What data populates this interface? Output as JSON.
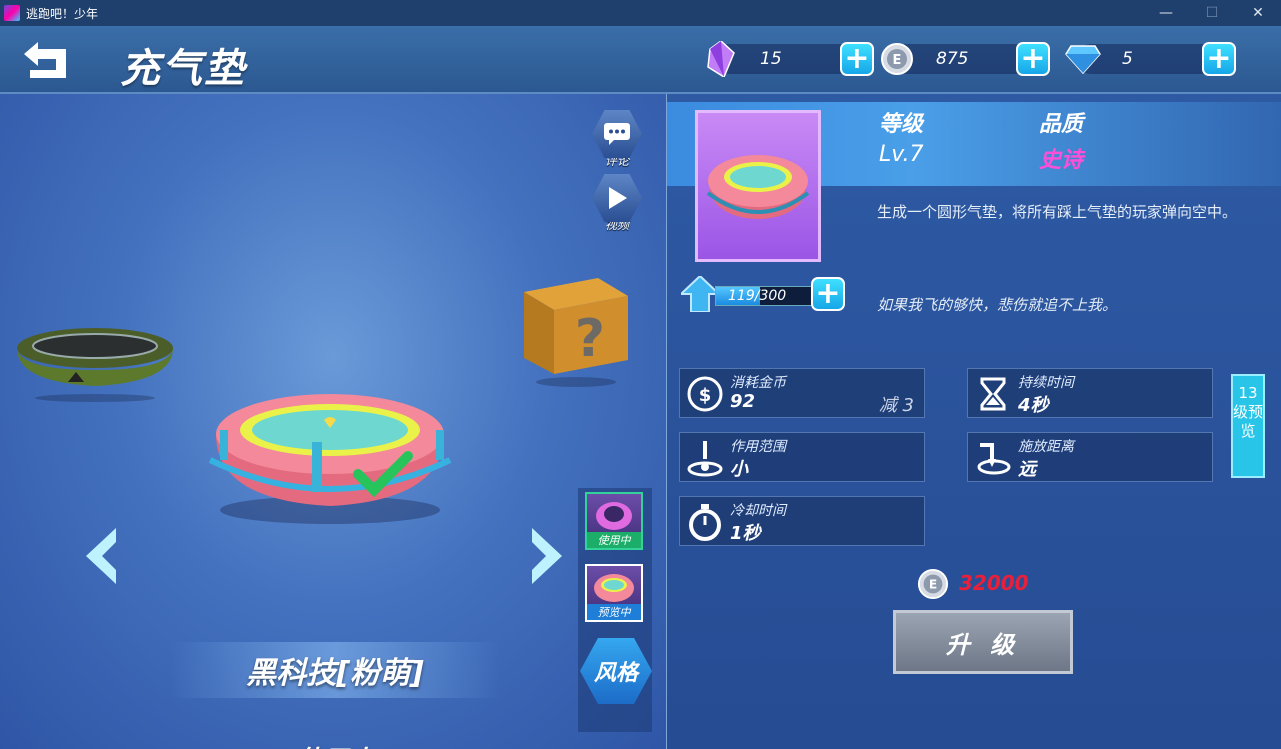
{
  "window": {
    "title": "逃跑吧！少年",
    "minimize": "—",
    "maximize": "☐",
    "close": "✕"
  },
  "header": {
    "page_title": "充气垫"
  },
  "currencies": [
    {
      "name": "crystal",
      "value": "15",
      "color": "#b56cf0"
    },
    {
      "name": "coin",
      "value": "875",
      "color": "#c7cfdc"
    },
    {
      "name": "diamond",
      "value": "5",
      "color": "#5fc7ff"
    }
  ],
  "side_buttons": {
    "comment": "评论",
    "video": "视频"
  },
  "styles": {
    "in_use_tag": "使用中",
    "preview_tag": "预览中",
    "style_button": "风格"
  },
  "skin": {
    "name": "黑科技[粉萌]",
    "status": "使用中"
  },
  "item": {
    "level_label": "等级",
    "level_value": "Lv.7",
    "quality_label": "品质",
    "quality_value": "史诗",
    "quality_color": "#ff4fd8",
    "description": "生成一个圆形气垫，将所有踩上气垫的玩家弹向空中。",
    "quote": "如果我飞的够快，悲伤就追不上我。",
    "exp_current": "119",
    "exp_max": "/300",
    "exp_fraction": 0.397
  },
  "stats": [
    {
      "name": "消耗金币",
      "value": "92",
      "extra": "减 3",
      "icon": "coin-stack-icon"
    },
    {
      "name": "持续时间",
      "value": "4秒",
      "extra": "",
      "icon": "hourglass-icon"
    },
    {
      "name": "作用范围",
      "value": "小",
      "extra": "",
      "icon": "range-icon"
    },
    {
      "name": "施放距离",
      "value": "远",
      "extra": "",
      "icon": "distance-icon"
    },
    {
      "name": "冷却时间",
      "value": "1秒",
      "extra": "",
      "icon": "stopwatch-icon"
    }
  ],
  "preview": {
    "label": "13级预览"
  },
  "upgrade": {
    "cost": "32000",
    "button": "升 级"
  }
}
